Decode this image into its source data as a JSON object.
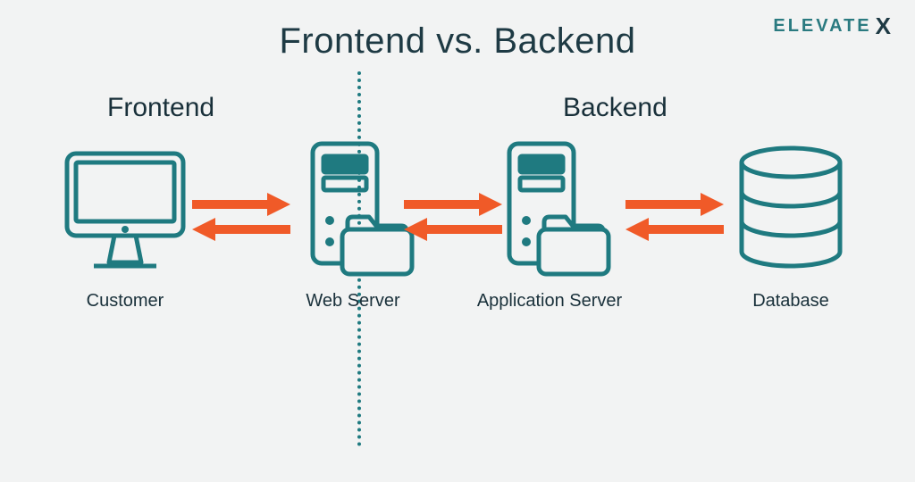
{
  "title": "Frontend vs. Backend",
  "logo": {
    "text": "ELEVATE",
    "suffix": "X"
  },
  "sections": {
    "frontend": "Frontend",
    "backend": "Backend"
  },
  "nodes": {
    "customer": {
      "label": "Customer",
      "icon": "monitor-icon"
    },
    "webserver": {
      "label": "Web Server",
      "icon": "server-folder-icon"
    },
    "appserver": {
      "label": "Application Server",
      "icon": "server-folder-icon"
    },
    "database": {
      "label": "Database",
      "icon": "database-icon"
    }
  },
  "flows": [
    {
      "from": "customer",
      "to": "webserver",
      "bidirectional": true
    },
    {
      "from": "webserver",
      "to": "appserver",
      "bidirectional": true
    },
    {
      "from": "appserver",
      "to": "database",
      "bidirectional": true
    }
  ],
  "colors": {
    "teal": "#1f7a80",
    "arrow": "#f05a28",
    "text": "#19303a",
    "bg": "#f2f3f3"
  }
}
